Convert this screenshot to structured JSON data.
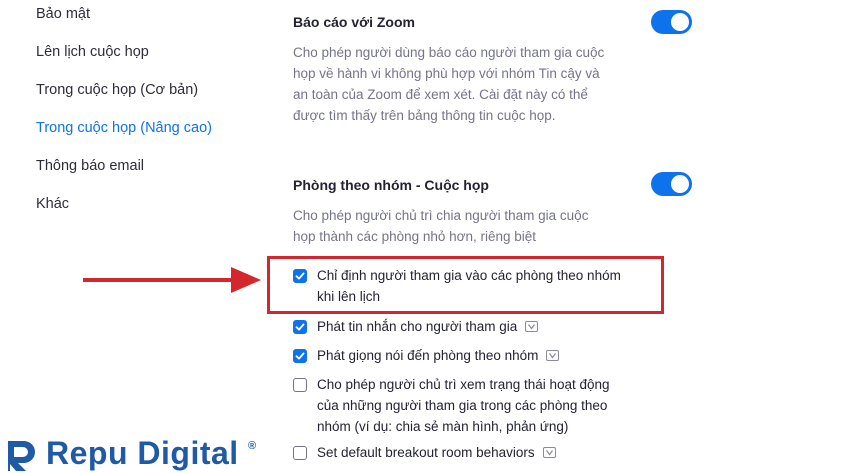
{
  "sidebar": {
    "items": [
      {
        "label": "Bảo mật",
        "active": false
      },
      {
        "label": "Lên lịch cuộc họp",
        "active": false
      },
      {
        "label": "Trong cuộc họp (Cơ bản)",
        "active": false
      },
      {
        "label": "Trong cuộc họp (Nâng cao)",
        "active": true
      },
      {
        "label": "Thông báo email",
        "active": false
      },
      {
        "label": "Khác",
        "active": false
      }
    ]
  },
  "settings": {
    "report_zoom": {
      "title": "Báo cáo với Zoom",
      "enabled": true,
      "desc_lines": [
        "Cho phép người dùng báo cáo người tham gia cuộc",
        "họp về hành vi không phù hợp với nhóm Tin cậy và",
        "an toàn của Zoom để xem xét. Cài đặt này có thể",
        "được tìm thấy trên bảng thông tin cuộc họp."
      ]
    },
    "breakout": {
      "title": "Phòng theo nhóm - Cuộc họp",
      "enabled": true,
      "desc_lines": [
        "Cho phép người chủ trì chia người tham gia cuộc",
        "họp thành các phòng nhỏ hơn, riêng biệt"
      ],
      "options": [
        {
          "lines": [
            "Chỉ định người tham gia vào các phòng theo nhóm",
            "khi lên lịch"
          ],
          "checked": true,
          "badge": false
        },
        {
          "lines": [
            "Phát tin nhắn cho người tham gia"
          ],
          "checked": true,
          "badge": true
        },
        {
          "lines": [
            "Phát giọng nói đến phòng theo nhóm"
          ],
          "checked": true,
          "badge": true
        },
        {
          "lines": [
            "Cho phép người chủ trì xem trạng thái hoạt động",
            "của những người tham gia trong các phòng theo",
            "nhóm (ví dụ: chia sẻ màn hình, phản ứng)"
          ],
          "checked": false,
          "badge": false
        },
        {
          "lines": [
            "Set default breakout room behaviors"
          ],
          "checked": false,
          "badge": true
        }
      ]
    }
  },
  "annotation": {
    "highlight_color": "#d3262d"
  },
  "watermark": {
    "text": "Repu Digital",
    "mark": "®"
  },
  "colors": {
    "accent": "#0e72ed",
    "muted": "#747487",
    "text": "#232333"
  },
  "icons": {
    "toggle": "toggle-on-icon",
    "checkbox": "checkbox-icon",
    "badge": "version-badge-icon",
    "arrow": "red-arrow-icon"
  }
}
